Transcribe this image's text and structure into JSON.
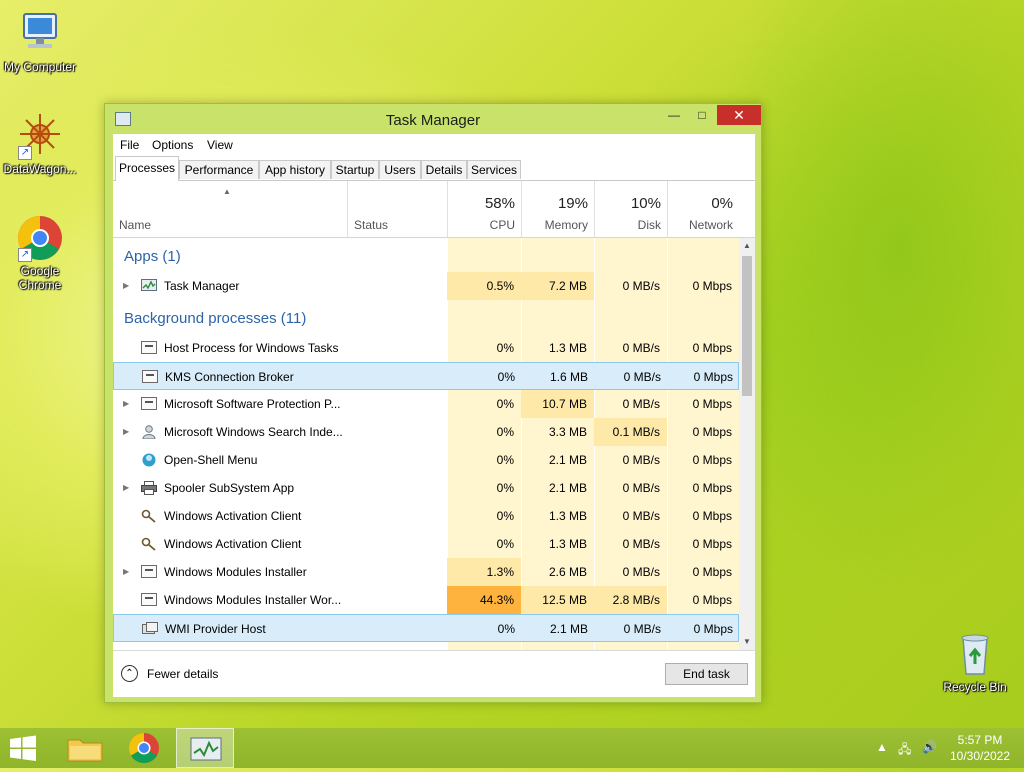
{
  "desktop": {
    "icons": [
      {
        "label": "My Computer"
      },
      {
        "label": "DataWagon..."
      },
      {
        "label": "Google Chrome"
      },
      {
        "label": "Recycle Bin"
      }
    ]
  },
  "window": {
    "title": "Task Manager",
    "controls": {
      "minimize": "—",
      "maximize": "□",
      "close": "✕"
    }
  },
  "menu": [
    "File",
    "Options",
    "View"
  ],
  "tabs": [
    "Processes",
    "Performance",
    "App history",
    "Startup",
    "Users",
    "Details",
    "Services"
  ],
  "active_tab": "Processes",
  "columns": {
    "name": "Name",
    "status": "Status",
    "cpu": {
      "label": "CPU",
      "percent": "58%"
    },
    "memory": {
      "label": "Memory",
      "percent": "19%"
    },
    "disk": {
      "label": "Disk",
      "percent": "10%"
    },
    "network": {
      "label": "Network",
      "percent": "0%"
    }
  },
  "groups": {
    "apps": "Apps (1)",
    "background": "Background processes (11)"
  },
  "apps": [
    {
      "name": "Task Manager",
      "cpu": "0.5%",
      "memory": "7.2 MB",
      "disk": "0 MB/s",
      "network": "0 Mbps",
      "icon": "task-manager-icon",
      "expandable": true
    }
  ],
  "background": [
    {
      "name": "Host Process for Windows Tasks",
      "cpu": "0%",
      "memory": "1.3 MB",
      "disk": "0 MB/s",
      "network": "0 Mbps",
      "icon": "window-process-icon",
      "expandable": false
    },
    {
      "name": "KMS Connection Broker",
      "cpu": "0%",
      "memory": "1.6 MB",
      "disk": "0 MB/s",
      "network": "0 Mbps",
      "icon": "window-process-icon",
      "expandable": false,
      "selected": true
    },
    {
      "name": "Microsoft Software Protection P...",
      "cpu": "0%",
      "memory": "10.7 MB",
      "disk": "0 MB/s",
      "network": "0 Mbps",
      "icon": "window-process-icon",
      "expandable": true
    },
    {
      "name": "Microsoft Windows Search Inde...",
      "cpu": "0%",
      "memory": "3.3 MB",
      "disk": "0.1 MB/s",
      "network": "0 Mbps",
      "icon": "search-person-icon",
      "expandable": true
    },
    {
      "name": "Open-Shell Menu",
      "cpu": "0%",
      "memory": "2.1 MB",
      "disk": "0 MB/s",
      "network": "0 Mbps",
      "icon": "shell-icon",
      "expandable": false
    },
    {
      "name": "Spooler SubSystem App",
      "cpu": "0%",
      "memory": "2.1 MB",
      "disk": "0 MB/s",
      "network": "0 Mbps",
      "icon": "printer-icon",
      "expandable": true
    },
    {
      "name": "Windows Activation Client",
      "cpu": "0%",
      "memory": "1.3 MB",
      "disk": "0 MB/s",
      "network": "0 Mbps",
      "icon": "key-icon",
      "expandable": false
    },
    {
      "name": "Windows Activation Client",
      "cpu": "0%",
      "memory": "1.3 MB",
      "disk": "0 MB/s",
      "network": "0 Mbps",
      "icon": "key-icon",
      "expandable": false
    },
    {
      "name": "Windows Modules Installer",
      "cpu": "1.3%",
      "memory": "2.6 MB",
      "disk": "0 MB/s",
      "network": "0 Mbps",
      "icon": "window-process-icon",
      "expandable": true
    },
    {
      "name": "Windows Modules Installer Wor...",
      "cpu": "44.3%",
      "memory": "12.5 MB",
      "disk": "2.8 MB/s",
      "network": "0 Mbps",
      "icon": "window-process-icon",
      "expandable": false
    },
    {
      "name": "WMI Provider Host",
      "cpu": "0%",
      "memory": "2.1 MB",
      "disk": "0 MB/s",
      "network": "0 Mbps",
      "icon": "wmi-icon",
      "expandable": false,
      "hover": true
    }
  ],
  "footer": {
    "fewer_details": "Fewer details",
    "end_task": "End task"
  },
  "taskbar": {
    "clock_time": "5:57 PM",
    "clock_date": "10/30/2022"
  }
}
